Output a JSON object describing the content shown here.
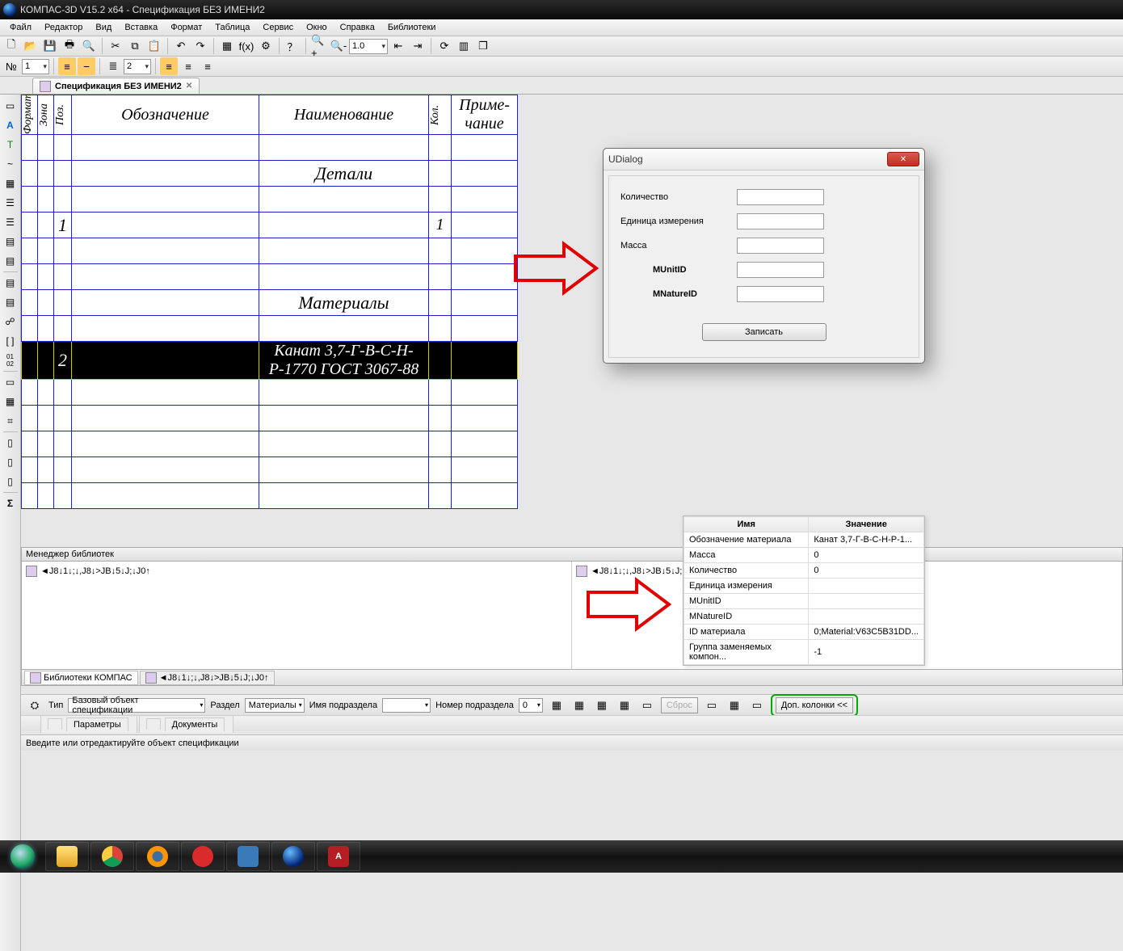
{
  "title": "КОМПАС-3D V15.2  x64 - Спецификация БЕЗ ИМЕНИ2",
  "menu": [
    "Файл",
    "Редактор",
    "Вид",
    "Вставка",
    "Формат",
    "Таблица",
    "Сервис",
    "Окно",
    "Справка",
    "Библиотеки"
  ],
  "toolbar1": {
    "zoom": "1.0"
  },
  "toolbar2": {
    "spin1": "1",
    "spin2": "2"
  },
  "doc_tab": "Спецификация БЕЗ ИМЕНИ2",
  "headers": {
    "format": "Формат",
    "zone": "Зона",
    "pos": "Поз.",
    "oboz": "Обозначение",
    "naim": "Наименование",
    "kol": "Кол.",
    "prim": "Приме-\nчание"
  },
  "rows": [
    {
      "type": "blank"
    },
    {
      "type": "section",
      "naim": "Детали"
    },
    {
      "type": "blank"
    },
    {
      "type": "item",
      "pos": "1",
      "kol": "1"
    },
    {
      "type": "blank"
    },
    {
      "type": "blank"
    },
    {
      "type": "section",
      "naim": "Материалы"
    },
    {
      "type": "blank"
    },
    {
      "type": "item",
      "selected": true,
      "pos": "2",
      "naim": "Канат 3,7-Г-В-С-Н-Р-1770 ГОСТ 3067-88"
    },
    {
      "type": "blank"
    },
    {
      "type": "blank"
    },
    {
      "type": "blank"
    },
    {
      "type": "blank"
    },
    {
      "type": "blank"
    }
  ],
  "libmgr": {
    "title": "Менеджер библиотек",
    "item1": "◄J8↓1↓;↓,J8↓>JB↓5↓J;↓J0↑",
    "item2": "◄J8↓1↓;↓,J8↓>JB↓5↓J;↓J0↑",
    "tab1": "Библиотеки КОМПАС",
    "tab2": "◄J8↓1↓;↓,J8↓>JB↓5↓J;↓J0↑"
  },
  "propgrid": {
    "col_name": "Имя",
    "col_value": "Значение",
    "rows": [
      {
        "n": "Обозначение материала",
        "v": "Канат 3,7-Г-В-С-Н-Р-1..."
      },
      {
        "n": "Масса",
        "v": "0"
      },
      {
        "n": "Количество",
        "v": "0"
      },
      {
        "n": "Единица измерения",
        "v": ""
      },
      {
        "n": "MUnitID",
        "v": ""
      },
      {
        "n": "MNatureID",
        "v": ""
      },
      {
        "n": "ID материала",
        "v": "0;Material:V63C5B31DD..."
      },
      {
        "n": "Группа заменяемых компон...",
        "v": "-1"
      }
    ]
  },
  "propbar": {
    "type_label": "Тип",
    "type_value": "Базовый объект спецификации",
    "section_label": "Раздел",
    "section_value": "Материалы",
    "subname_label": "Имя подраздела",
    "subno_label": "Номер подраздела",
    "subno_value": "0",
    "reset": "Сброс",
    "extra_cols": "Доп. колонки  <<",
    "tab_params": "Параметры",
    "tab_docs": "Документы"
  },
  "status": "Введите или отредактируйте объект спецификации",
  "udialog": {
    "title": "UDialog",
    "f_qty": "Количество",
    "f_unit": "Единица измерения",
    "f_mass": "Масса",
    "f_munit": "MUnitID",
    "f_mnat": "MNatureID",
    "submit": "Записать"
  }
}
